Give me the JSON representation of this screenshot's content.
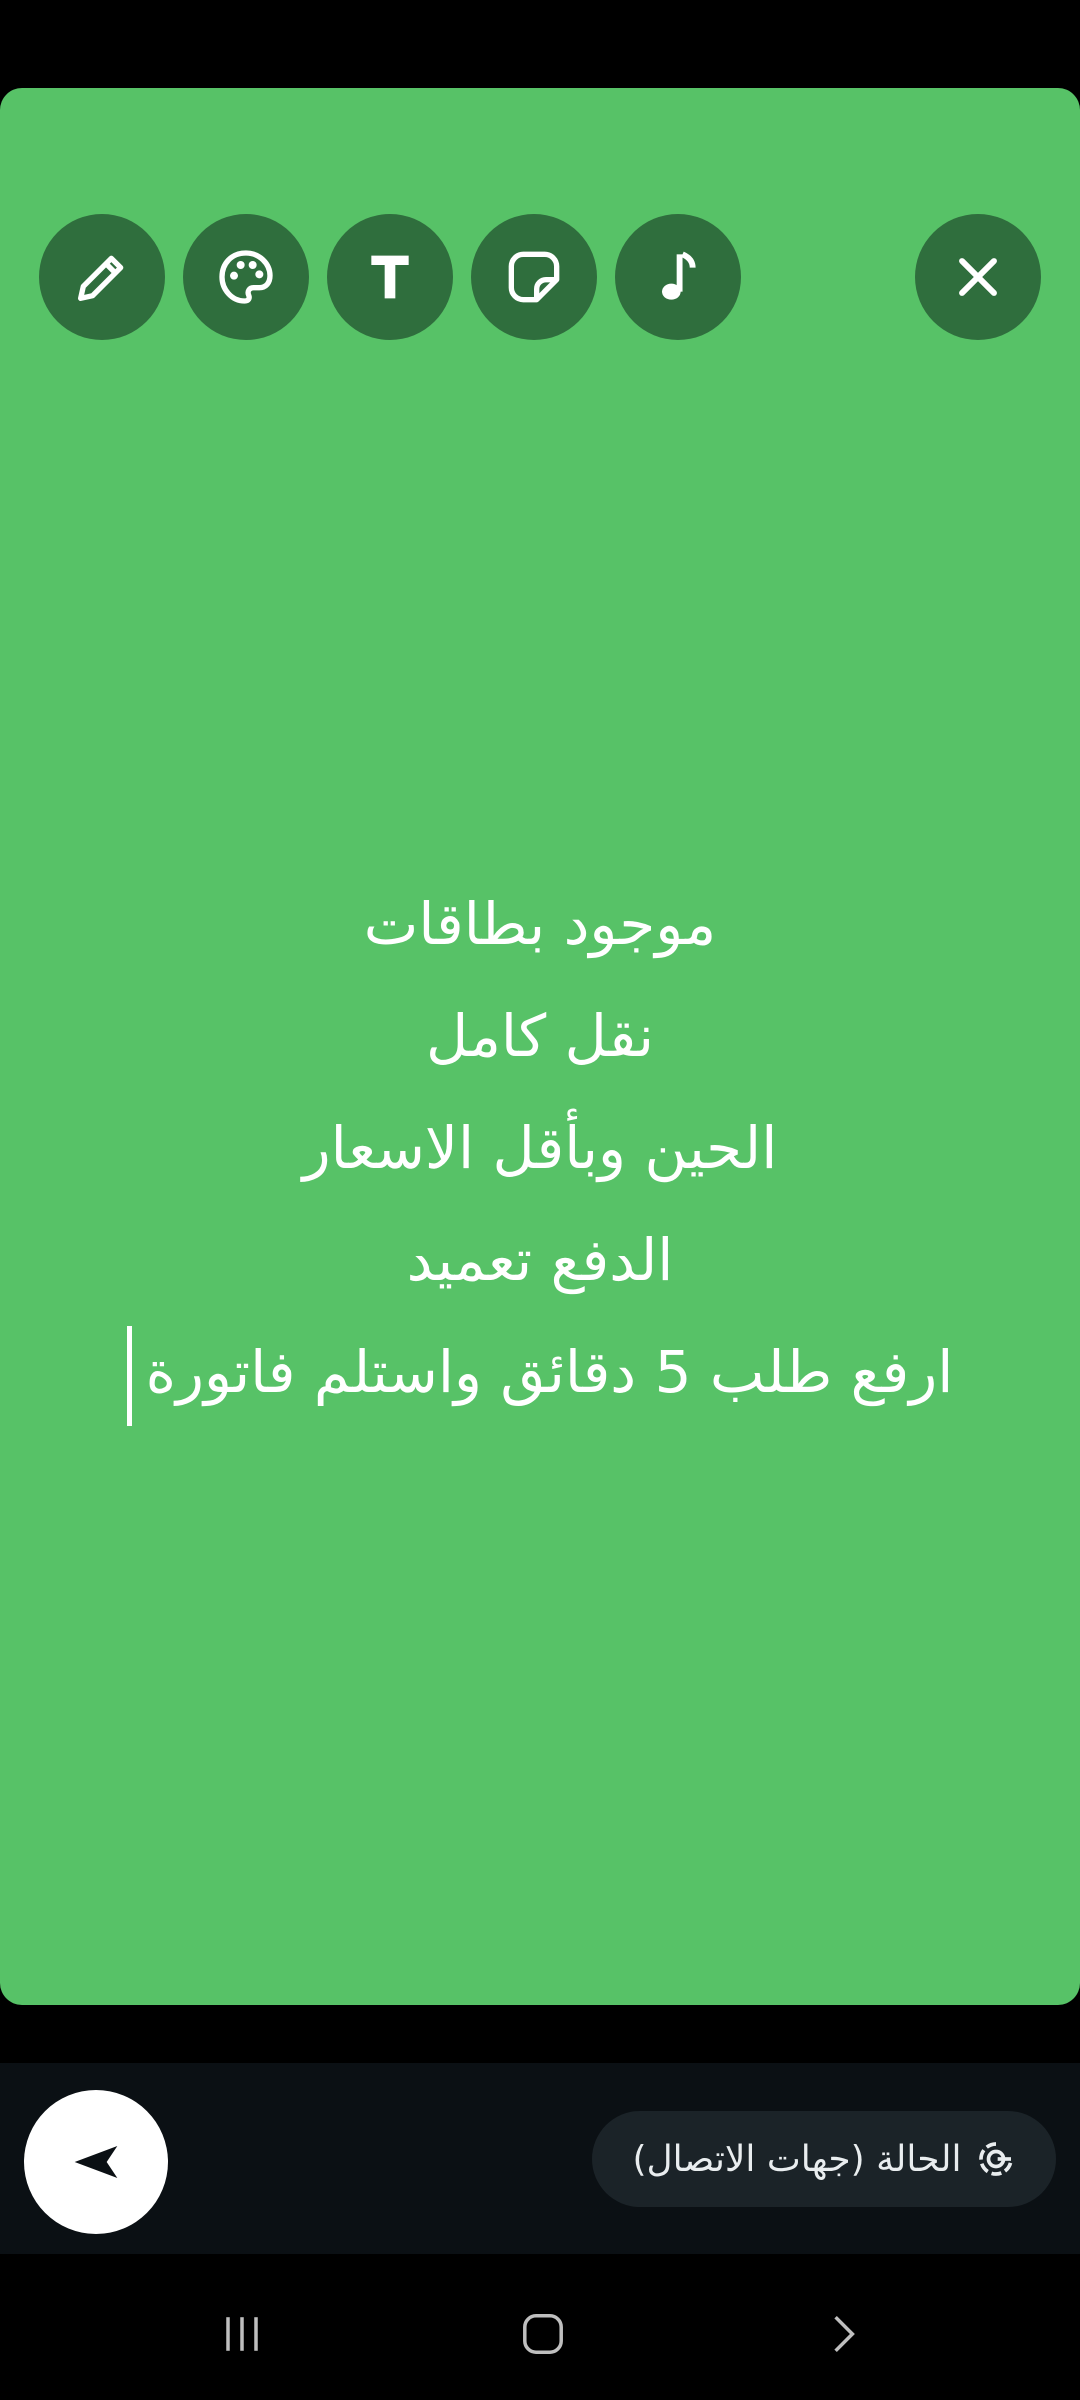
{
  "editor": {
    "background_color": "#57c267",
    "tools": [
      {
        "name": "pencil-icon"
      },
      {
        "name": "palette-icon"
      },
      {
        "name": "text-icon"
      },
      {
        "name": "sticker-icon"
      },
      {
        "name": "music-icon"
      }
    ],
    "close_icon": "close-icon"
  },
  "status_text": {
    "lines": [
      "موجود بطاقات",
      "نقل كامل",
      "الحين وبأقل الاسعار",
      "الدفع تعميد",
      "ارفع طلب  5 دقائق واستلم فاتورة"
    ]
  },
  "bottom_bar": {
    "audience_label": "الحالة (جهات الاتصال)",
    "audience_icon": "status-ring-icon",
    "send_icon": "send-icon"
  },
  "nav": {
    "recents_icon": "recents-icon",
    "home_icon": "home-icon",
    "back_icon": "back-icon"
  }
}
